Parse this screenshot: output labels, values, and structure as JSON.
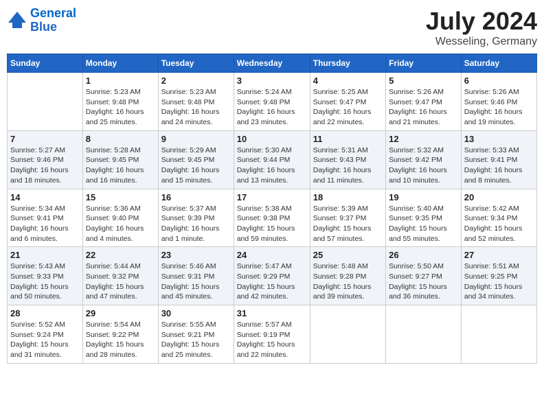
{
  "header": {
    "logo_line1": "General",
    "logo_line2": "Blue",
    "title": "July 2024",
    "subtitle": "Wesseling, Germany"
  },
  "columns": [
    "Sunday",
    "Monday",
    "Tuesday",
    "Wednesday",
    "Thursday",
    "Friday",
    "Saturday"
  ],
  "weeks": [
    [
      {
        "day": "",
        "info": ""
      },
      {
        "day": "1",
        "info": "Sunrise: 5:23 AM\nSunset: 9:48 PM\nDaylight: 16 hours\nand 25 minutes."
      },
      {
        "day": "2",
        "info": "Sunrise: 5:23 AM\nSunset: 9:48 PM\nDaylight: 16 hours\nand 24 minutes."
      },
      {
        "day": "3",
        "info": "Sunrise: 5:24 AM\nSunset: 9:48 PM\nDaylight: 16 hours\nand 23 minutes."
      },
      {
        "day": "4",
        "info": "Sunrise: 5:25 AM\nSunset: 9:47 PM\nDaylight: 16 hours\nand 22 minutes."
      },
      {
        "day": "5",
        "info": "Sunrise: 5:26 AM\nSunset: 9:47 PM\nDaylight: 16 hours\nand 21 minutes."
      },
      {
        "day": "6",
        "info": "Sunrise: 5:26 AM\nSunset: 9:46 PM\nDaylight: 16 hours\nand 19 minutes."
      }
    ],
    [
      {
        "day": "7",
        "info": "Sunrise: 5:27 AM\nSunset: 9:46 PM\nDaylight: 16 hours\nand 18 minutes."
      },
      {
        "day": "8",
        "info": "Sunrise: 5:28 AM\nSunset: 9:45 PM\nDaylight: 16 hours\nand 16 minutes."
      },
      {
        "day": "9",
        "info": "Sunrise: 5:29 AM\nSunset: 9:45 PM\nDaylight: 16 hours\nand 15 minutes."
      },
      {
        "day": "10",
        "info": "Sunrise: 5:30 AM\nSunset: 9:44 PM\nDaylight: 16 hours\nand 13 minutes."
      },
      {
        "day": "11",
        "info": "Sunrise: 5:31 AM\nSunset: 9:43 PM\nDaylight: 16 hours\nand 11 minutes."
      },
      {
        "day": "12",
        "info": "Sunrise: 5:32 AM\nSunset: 9:42 PM\nDaylight: 16 hours\nand 10 minutes."
      },
      {
        "day": "13",
        "info": "Sunrise: 5:33 AM\nSunset: 9:41 PM\nDaylight: 16 hours\nand 8 minutes."
      }
    ],
    [
      {
        "day": "14",
        "info": "Sunrise: 5:34 AM\nSunset: 9:41 PM\nDaylight: 16 hours\nand 6 minutes."
      },
      {
        "day": "15",
        "info": "Sunrise: 5:36 AM\nSunset: 9:40 PM\nDaylight: 16 hours\nand 4 minutes."
      },
      {
        "day": "16",
        "info": "Sunrise: 5:37 AM\nSunset: 9:39 PM\nDaylight: 16 hours\nand 1 minute."
      },
      {
        "day": "17",
        "info": "Sunrise: 5:38 AM\nSunset: 9:38 PM\nDaylight: 15 hours\nand 59 minutes."
      },
      {
        "day": "18",
        "info": "Sunrise: 5:39 AM\nSunset: 9:37 PM\nDaylight: 15 hours\nand 57 minutes."
      },
      {
        "day": "19",
        "info": "Sunrise: 5:40 AM\nSunset: 9:35 PM\nDaylight: 15 hours\nand 55 minutes."
      },
      {
        "day": "20",
        "info": "Sunrise: 5:42 AM\nSunset: 9:34 PM\nDaylight: 15 hours\nand 52 minutes."
      }
    ],
    [
      {
        "day": "21",
        "info": "Sunrise: 5:43 AM\nSunset: 9:33 PM\nDaylight: 15 hours\nand 50 minutes."
      },
      {
        "day": "22",
        "info": "Sunrise: 5:44 AM\nSunset: 9:32 PM\nDaylight: 15 hours\nand 47 minutes."
      },
      {
        "day": "23",
        "info": "Sunrise: 5:46 AM\nSunset: 9:31 PM\nDaylight: 15 hours\nand 45 minutes."
      },
      {
        "day": "24",
        "info": "Sunrise: 5:47 AM\nSunset: 9:29 PM\nDaylight: 15 hours\nand 42 minutes."
      },
      {
        "day": "25",
        "info": "Sunrise: 5:48 AM\nSunset: 9:28 PM\nDaylight: 15 hours\nand 39 minutes."
      },
      {
        "day": "26",
        "info": "Sunrise: 5:50 AM\nSunset: 9:27 PM\nDaylight: 15 hours\nand 36 minutes."
      },
      {
        "day": "27",
        "info": "Sunrise: 5:51 AM\nSunset: 9:25 PM\nDaylight: 15 hours\nand 34 minutes."
      }
    ],
    [
      {
        "day": "28",
        "info": "Sunrise: 5:52 AM\nSunset: 9:24 PM\nDaylight: 15 hours\nand 31 minutes."
      },
      {
        "day": "29",
        "info": "Sunrise: 5:54 AM\nSunset: 9:22 PM\nDaylight: 15 hours\nand 28 minutes."
      },
      {
        "day": "30",
        "info": "Sunrise: 5:55 AM\nSunset: 9:21 PM\nDaylight: 15 hours\nand 25 minutes."
      },
      {
        "day": "31",
        "info": "Sunrise: 5:57 AM\nSunset: 9:19 PM\nDaylight: 15 hours\nand 22 minutes."
      },
      {
        "day": "",
        "info": ""
      },
      {
        "day": "",
        "info": ""
      },
      {
        "day": "",
        "info": ""
      }
    ]
  ]
}
